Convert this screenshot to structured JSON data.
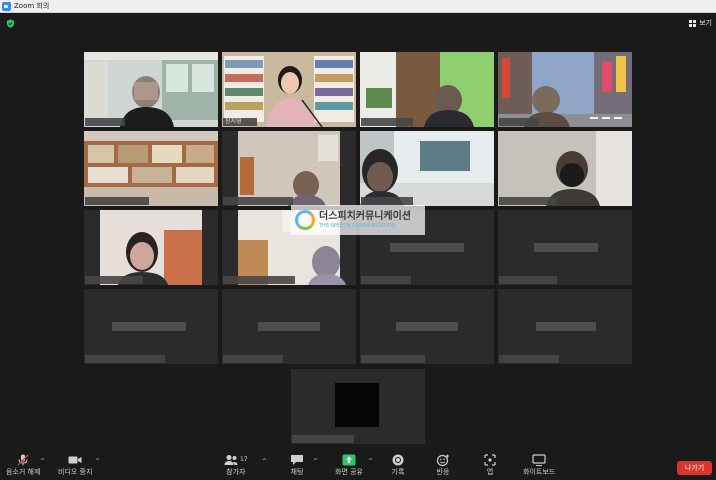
{
  "window": {
    "title": "Zoom 회의"
  },
  "header": {
    "view_label": "보기"
  },
  "gallery": {
    "speaker_name": "장지영",
    "watermark_title": "더스피치커뮤니케이션",
    "watermark_subtitle": "THE SPEECH COMMUNICATION"
  },
  "toolbar": {
    "mute_label": "음소거 해제",
    "video_label": "비디오 중지",
    "participants_label": "참가자",
    "participants_count": "17",
    "chat_label": "채팅",
    "share_label": "화면 공유",
    "record_label": "기록",
    "reactions_label": "반응",
    "apps_label": "앱",
    "whiteboard_label": "화이트보드",
    "leave_label": "나가기"
  },
  "colors": {
    "active_speaker_border": "#e6e37a",
    "share_green": "#2ec66b",
    "leave_red": "#d9342c",
    "zoom_blue": "#2d8cff"
  }
}
